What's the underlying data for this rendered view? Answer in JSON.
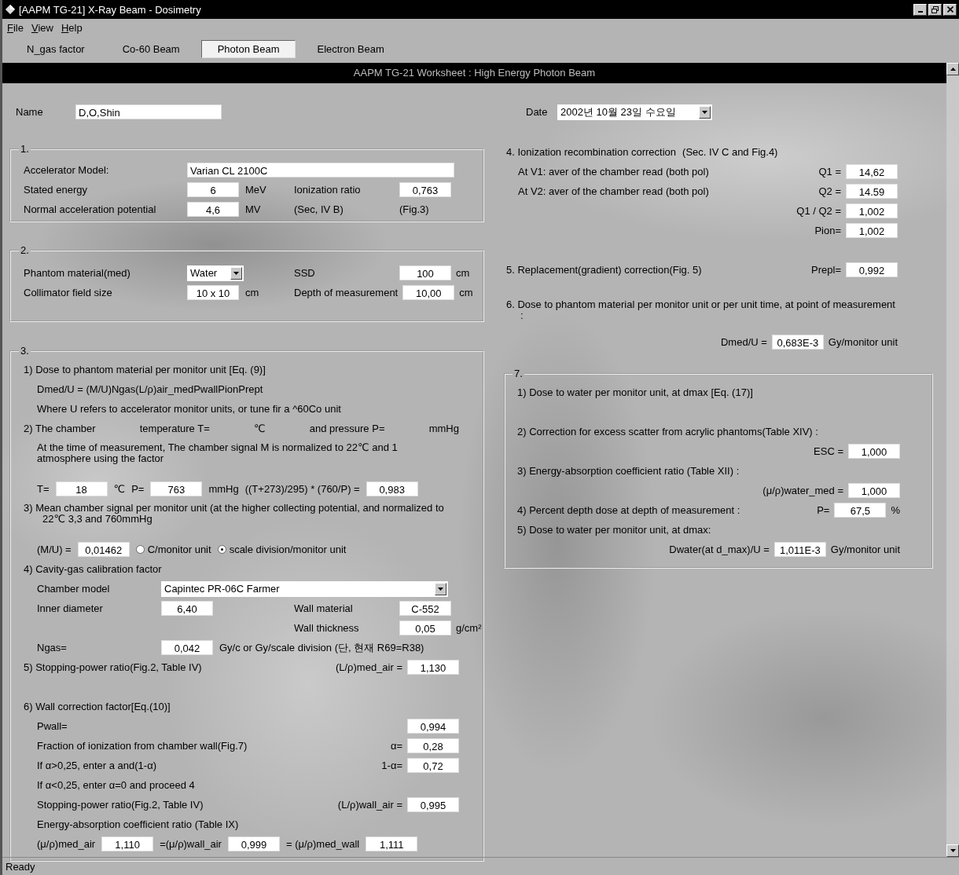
{
  "window": {
    "title": "[AAPM TG-21] X-Ray Beam - Dosimetry"
  },
  "menu": [
    "File",
    "View",
    "Help"
  ],
  "tabs": [
    {
      "label": "N_gas factor",
      "selected": false
    },
    {
      "label": "Co-60 Beam",
      "selected": false
    },
    {
      "label": "Photon Beam",
      "selected": true
    },
    {
      "label": "Electron Beam",
      "selected": false
    }
  ],
  "worksheet_title": "AAPM TG-21 Worksheet : High Energy Photon Beam",
  "left_panel": {
    "top_row": {
      "kind": "form",
      "items": [
        {
          "kind": "text",
          "text": "Name"
        },
        {
          "kind": "entry",
          "value": "D,O,Shin"
        }
      ]
    },
    "groups": [
      {
        "legend": "1.",
        "parts": [
          {
            "rows": [
              {
                "kind": "form",
                "items": [
                  {
                    "kind": "text",
                    "text": "Accelerator Model:"
                  },
                  {
                    "kind": "entry",
                    "value": "Varian CL 2100C"
                  }
                ]
              },
              {
                "kind": "pair",
                "left": [
                  {
                    "kind": "text",
                    "text": "Stated energy"
                  },
                  {
                    "kind": "field",
                    "value": "6"
                  },
                  {
                    "kind": "text",
                    "text": "MeV"
                  }
                ],
                "right": [
                  {
                    "kind": "text",
                    "text": "Ionization ratio"
                  },
                  {
                    "kind": "field",
                    "value": "0,763"
                  }
                ]
              },
              {
                "kind": "pair",
                "left": [
                  {
                    "kind": "text",
                    "text": "Normal acceleration potential"
                  },
                  {
                    "kind": "field",
                    "value": "4,6"
                  },
                  {
                    "kind": "text",
                    "text": "MV"
                  }
                ],
                "right": [
                  {
                    "kind": "text",
                    "text": "(Sec, IV B)"
                  },
                  {
                    "kind": "text",
                    "text": "(Fig.3)"
                  }
                ]
              }
            ]
          }
        ]
      },
      {
        "legend": "2.",
        "parts": [
          {
            "rows": [
              {
                "kind": "pair",
                "left": [
                  {
                    "kind": "text",
                    "text": "Phantom material(med)"
                  },
                  {
                    "kind": "picker",
                    "value": "Water"
                  }
                ],
                "right": [
                  {
                    "kind": "text",
                    "text": "SSD"
                  },
                  {
                    "kind": "field",
                    "value": "100"
                  },
                  {
                    "kind": "text",
                    "text": "cm"
                  }
                ]
              },
              {
                "kind": "pair",
                "left": [
                  {
                    "kind": "text",
                    "text": "Collimator field size"
                  },
                  {
                    "kind": "field",
                    "value": "10 x 10"
                  },
                  {
                    "kind": "text",
                    "text": "cm"
                  }
                ],
                "right": [
                  {
                    "kind": "text",
                    "text": "Depth of measurement"
                  },
                  {
                    "kind": "field",
                    "value": "10,00"
                  },
                  {
                    "kind": "text",
                    "text": "cm"
                  }
                ]
              }
            ]
          }
        ]
      },
      {
        "legend": "3.",
        "parts": [
          {
            "heading": {
              "kind": "line",
              "items": [
                {
                  "kind": "text",
                  "text": "1) Dose to phantom material per monitor unit [Eq. (9)]"
                }
              ]
            },
            "rows": [
              {
                "kind": "line",
                "items": [
                  {
                    "kind": "text",
                    "text": "Dmed/U = (M/U)Ngas(L/ρ)air_medPwallPionPrept"
                  }
                ]
              },
              {
                "kind": "line",
                "items": [
                  {
                    "kind": "text",
                    "text": "Where U refers to accelerator monitor units, or tune fir a ^60Co unit"
                  }
                ]
              }
            ]
          },
          {
            "heading": {
              "kind": "spread",
              "items": [
                {
                  "kind": "text",
                  "text": "2) The chamber"
                },
                {
                  "kind": "text",
                  "text": "temperature T="
                },
                {
                  "kind": "text",
                  "text": "℃"
                },
                {
                  "kind": "text",
                  "text": "and pressure P="
                },
                {
                  "kind": "text",
                  "text": "mmHg"
                }
              ]
            },
            "rows": [
              {
                "kind": "para",
                "text": "At the time of measurement, The chamber signal M is normalized to 22℃ and  1 atmosphere using the factor"
              },
              {
                "kind": "line",
                "items": [
                  {
                    "kind": "text",
                    "text": "T="
                  },
                  {
                    "kind": "field",
                    "value": "18"
                  },
                  {
                    "kind": "text",
                    "text": "℃"
                  },
                  {
                    "kind": "text",
                    "text": "P="
                  },
                  {
                    "kind": "field",
                    "value": "763"
                  },
                  {
                    "kind": "text",
                    "text": "mmHg"
                  },
                  {
                    "kind": "text",
                    "text": "((T+273)/295) * (760/P) ="
                  },
                  {
                    "kind": "field",
                    "value": "0,983"
                  }
                ]
              }
            ]
          },
          {
            "heading": {
              "kind": "para",
              "text": "3)  Mean chamber signal per monitor unit (at the higher collecting potential, and normalized to 22℃ 3,3 and 760mmHg"
            },
            "rows": [
              {
                "kind": "line",
                "items": [
                  {
                    "kind": "text",
                    "text": "(M/U) ="
                  },
                  {
                    "kind": "field",
                    "value": "0,01462"
                  },
                  {
                    "kind": "radio",
                    "label": "C/monitor unit",
                    "selected": false
                  },
                  {
                    "kind": "radio",
                    "label": "scale division/monitor unit",
                    "selected": true
                  }
                ]
              }
            ]
          },
          {
            "heading": {
              "kind": "line",
              "items": [
                {
                  "kind": "text",
                  "text": "4) Cavity-gas calibration factor"
                }
              ]
            },
            "rows": [
              {
                "kind": "form",
                "items": [
                  {
                    "kind": "text",
                    "text": "Chamber model"
                  },
                  {
                    "kind": "combo",
                    "value": "Capintec PR-06C Farmer"
                  }
                ]
              },
              {
                "kind": "pair",
                "left": [
                  {
                    "kind": "text",
                    "text": "Inner diameter"
                  },
                  {
                    "kind": "field",
                    "value": "6,40"
                  }
                ],
                "right": [
                  {
                    "kind": "text",
                    "text": "Wall material"
                  },
                  {
                    "kind": "field",
                    "value": "C-552"
                  }
                ]
              },
              {
                "kind": "pair",
                "right": [
                  {
                    "kind": "text",
                    "text": "Wall thickness"
                  },
                  {
                    "kind": "field",
                    "value": "0,05"
                  },
                  {
                    "kind": "text",
                    "text": "g/cm²"
                  }
                ]
              },
              {
                "kind": "pair",
                "left": [
                  {
                    "kind": "text",
                    "text": "Ngas="
                  },
                  {
                    "kind": "field",
                    "value": "0,042"
                  },
                  {
                    "kind": "text",
                    "text": "Gy/c or Gy/scale division (단, 현재 R69=R38)"
                  }
                ]
              }
            ]
          },
          {
            "heading": {
              "kind": "split",
              "left": [
                {
                  "kind": "text",
                  "text": "5) Stopping-power ratio(Fig.2, Table IV)"
                }
              ],
              "right": [
                {
                  "kind": "text",
                  "text": "(L/ρ)med_air ="
                },
                {
                  "kind": "field",
                  "value": "1,130"
                }
              ]
            }
          },
          {
            "heading": {
              "kind": "line",
              "items": [
                {
                  "kind": "text",
                  "text": "6) Wall correction factor[Eq.(10)]"
                }
              ]
            },
            "rows": [
              {
                "kind": "split",
                "left": [
                  {
                    "kind": "text",
                    "text": "Pwall="
                  }
                ],
                "right": [
                  {
                    "kind": "field",
                    "value": "0,994"
                  }
                ]
              },
              {
                "kind": "split",
                "left": [
                  {
                    "kind": "text",
                    "text": "Fraction of ionization from chamber wall(Fig.7)"
                  }
                ],
                "right": [
                  {
                    "kind": "text",
                    "text": "α="
                  },
                  {
                    "kind": "field",
                    "value": "0,28"
                  }
                ]
              },
              {
                "kind": "split",
                "left": [
                  {
                    "kind": "text",
                    "text": "If α>0,25, enter a and(1-α)"
                  }
                ],
                "right": [
                  {
                    "kind": "text",
                    "text": "1-α="
                  },
                  {
                    "kind": "field",
                    "value": "0,72"
                  }
                ]
              },
              {
                "kind": "line",
                "items": [
                  {
                    "kind": "text",
                    "text": "If α<0,25, enter α=0 and proceed 4"
                  }
                ]
              },
              {
                "kind": "split",
                "left": [
                  {
                    "kind": "text",
                    "text": "Stopping-power ratio(Fig.2, Table IV)"
                  }
                ],
                "right": [
                  {
                    "kind": "text",
                    "text": "(L/ρ)wall_air ="
                  },
                  {
                    "kind": "field",
                    "value": "0,995"
                  }
                ]
              },
              {
                "kind": "line",
                "items": [
                  {
                    "kind": "text",
                    "text": "Energy-absorption coefficient ratio (Table IX)"
                  }
                ]
              },
              {
                "kind": "line",
                "items": [
                  {
                    "kind": "text",
                    "text": "(μ/ρ)med_air"
                  },
                  {
                    "kind": "field",
                    "value": "1,110"
                  },
                  {
                    "kind": "text",
                    "text": "=(μ/ρ)wall_air"
                  },
                  {
                    "kind": "field",
                    "value": "0,999"
                  },
                  {
                    "kind": "text",
                    "text": "=  (μ/ρ)med_wall"
                  },
                  {
                    "kind": "field",
                    "value": "1,111"
                  }
                ]
              }
            ]
          }
        ]
      }
    ]
  },
  "right_panel": {
    "top_row": {
      "kind": "form",
      "items": [
        {
          "kind": "text",
          "text": "Date"
        },
        {
          "kind": "combo",
          "value": "2002년 10월 23일 수요일"
        }
      ]
    },
    "groups": [
      {
        "parts": [
          {
            "heading": {
              "kind": "line",
              "items": [
                {
                  "kind": "text",
                  "text": "4. Ionization recombination correction"
                },
                {
                  "kind": "text",
                  "text": "(Sec. IV C and Fig.4)"
                }
              ]
            },
            "rows": [
              {
                "kind": "split",
                "left": [
                  {
                    "kind": "text",
                    "text": "At V1: aver of the chamber read (both pol)"
                  }
                ],
                "right": [
                  {
                    "kind": "text",
                    "text": "Q1 ="
                  },
                  {
                    "kind": "field",
                    "value": "14,62"
                  }
                ]
              },
              {
                "kind": "split",
                "left": [
                  {
                    "kind": "text",
                    "text": "At V2: aver of the chamber read (both pol)"
                  }
                ],
                "right": [
                  {
                    "kind": "text",
                    "text": "Q2 ="
                  },
                  {
                    "kind": "field",
                    "value": "14.59"
                  }
                ]
              },
              {
                "kind": "right",
                "items": [
                  {
                    "kind": "text",
                    "text": "Q1 / Q2 ="
                  },
                  {
                    "kind": "field",
                    "value": "1,002"
                  }
                ]
              },
              {
                "kind": "right",
                "items": [
                  {
                    "kind": "text",
                    "text": "Pion="
                  },
                  {
                    "kind": "field",
                    "value": "1,002"
                  }
                ]
              }
            ]
          },
          {
            "heading": {
              "kind": "split",
              "left": [
                {
                  "kind": "text",
                  "text": "5. Replacement(gradient) correction(Fig. 5)"
                }
              ],
              "right": [
                {
                  "kind": "text",
                  "text": "Prepl="
                },
                {
                  "kind": "field",
                  "value": "0,992"
                }
              ]
            }
          },
          {
            "heading": {
              "kind": "para",
              "text": "6. Dose to phantom material per monitor unit or per unit time, at point of measurement :"
            },
            "rows": [
              {
                "kind": "right",
                "items": [
                  {
                    "kind": "text",
                    "text": "Dmed/U ="
                  },
                  {
                    "kind": "field",
                    "value": "0,683E-3"
                  },
                  {
                    "kind": "text",
                    "text": "Gy/monitor unit"
                  }
                ]
              }
            ]
          }
        ]
      },
      {
        "legend": "7.",
        "parts": [
          {
            "heading": {
              "kind": "line",
              "items": [
                {
                  "kind": "text",
                  "text": "1) Dose to water per monitor unit, at dmax [Eq. (17)]"
                }
              ]
            }
          },
          {
            "heading": {
              "kind": "line",
              "items": [
                {
                  "kind": "text",
                  "text": "2) Correction for excess scatter from acrylic phantoms(Table XIV) :"
                }
              ]
            },
            "rows": [
              {
                "kind": "right",
                "items": [
                  {
                    "kind": "text",
                    "text": "ESC ="
                  },
                  {
                    "kind": "field",
                    "value": "1,000"
                  }
                ]
              }
            ]
          },
          {
            "heading": {
              "kind": "line",
              "items": [
                {
                  "kind": "text",
                  "text": "3) Energy-absorption coefficient ratio (Table XII) :"
                }
              ]
            },
            "rows": [
              {
                "kind": "right",
                "items": [
                  {
                    "kind": "text",
                    "text": "(μ/ρ)water_med ="
                  },
                  {
                    "kind": "field",
                    "value": "1,000"
                  }
                ]
              }
            ]
          },
          {
            "heading": {
              "kind": "split",
              "left": [
                {
                  "kind": "text",
                  "text": "4) Percent depth dose at depth of measurement :"
                }
              ],
              "right": [
                {
                  "kind": "text",
                  "text": "P="
                },
                {
                  "kind": "field",
                  "value": "67,5"
                },
                {
                  "kind": "text",
                  "text": "%"
                }
              ]
            }
          },
          {
            "heading": {
              "kind": "line",
              "items": [
                {
                  "kind": "text",
                  "text": "5) Dose to water per monitor unit, at dmax:"
                }
              ]
            },
            "rows": [
              {
                "kind": "right",
                "items": [
                  {
                    "kind": "text",
                    "text": "Dwater(at d_max)/U ="
                  },
                  {
                    "kind": "field",
                    "value": "1,011E-3"
                  },
                  {
                    "kind": "text",
                    "text": "Gy/monitor unit"
                  }
                ]
              }
            ]
          }
        ]
      }
    ]
  },
  "status_bar": "Ready"
}
